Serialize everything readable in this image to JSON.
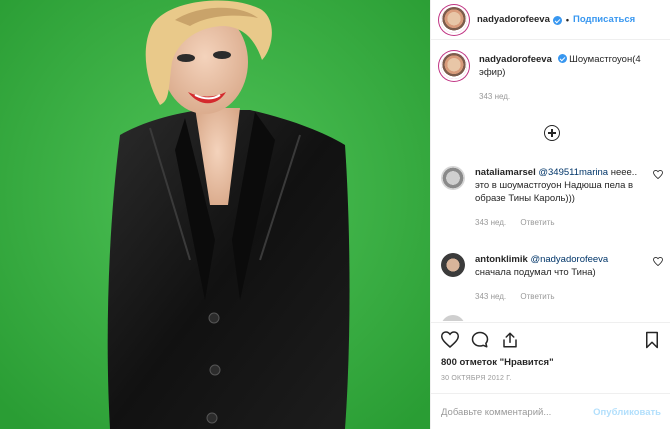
{
  "post": {
    "author": "nadyadorofeeva",
    "follow_label": "Подписаться",
    "separator": "•"
  },
  "caption": {
    "user": "nadyadorofeeva",
    "text": "Шоумастгоуон(4 эфир)",
    "time": "343 нед."
  },
  "comments": [
    {
      "user": "nataliamarsel",
      "mention": "@349511marina",
      "text": "неее.. это в шоумастгоуон Надюша пела в образе Тины Кароль)))",
      "time": "343 нед.",
      "reply_label": "Ответить"
    },
    {
      "user": "antonklimik",
      "mention": "@nadyadorofeeva",
      "text": "сначала подумал что Тина)",
      "time": "343 нед.",
      "reply_label": "Ответить"
    }
  ],
  "likes_text": "800 отметок \"Нравится\"",
  "date_text": "30 ОКТЯБРЯ 2012 Г.",
  "comment_box": {
    "placeholder": "Добавьте комментарий...",
    "publish_label": "Опубликовать"
  },
  "icons": [
    "heart-icon",
    "comment-icon",
    "share-icon",
    "bookmark-icon",
    "add-more-icon",
    "verified-icon"
  ],
  "colors": {
    "photo_background": "#35b23f",
    "link": "#3897f0",
    "muted": "#999999",
    "publish_disabled": "#b2dffc"
  }
}
